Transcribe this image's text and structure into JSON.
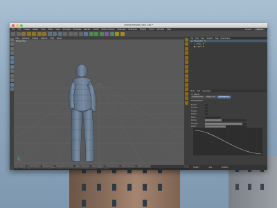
{
  "window": {
    "title": "characermodel_var1.c4d *"
  },
  "menubar": {
    "items": [
      "File",
      "Edit",
      "Create",
      "Select",
      "Tools",
      "Mesh",
      "Snap",
      "Animate",
      "Simulate",
      "Render",
      "Sculpt",
      "Motion Tracker",
      "MoGraph",
      "Character",
      "Plugins",
      "Script",
      "Window",
      "Help"
    ],
    "layout_label": "Layout:",
    "layout_value": "Startup"
  },
  "viewport": {
    "menu": [
      "View",
      "Cameras",
      "Display",
      "Options",
      "Filter",
      "Panel"
    ],
    "label": "Perspective"
  },
  "object_manager": {
    "menu": [
      "File",
      "Edit",
      "View",
      "Objects",
      "Tags",
      "Bookmarks"
    ],
    "objects": [
      {
        "name": "Character",
        "selected": true
      },
      {
        "name": "Body",
        "selected": false
      },
      {
        "name": "Light",
        "selected": false
      }
    ]
  },
  "attribute_manager": {
    "menu": [
      "Mode",
      "Edit",
      "User Data"
    ],
    "title": "Move",
    "tabs": [
      "Modeling Axis",
      "Object Axis",
      "Soft Selection"
    ],
    "active_tab": "Soft Selection",
    "section": "Soft Selection",
    "fields": [
      {
        "label": "Enable",
        "value": ""
      },
      {
        "label": "Preview",
        "value": ""
      },
      {
        "label": "Surface",
        "value": ""
      },
      {
        "label": "Rubber",
        "value": ""
      },
      {
        "label": "Mode",
        "value": ""
      },
      {
        "label": "Radius",
        "value": "",
        "fill": 0.4
      },
      {
        "label": "Strength",
        "value": "",
        "fill": 0.9
      },
      {
        "label": "Width",
        "value": "",
        "fill": 0.5
      }
    ]
  },
  "coordinates": {
    "headers": [
      "Position",
      "Size",
      "Rotation"
    ]
  },
  "bottom_tabs": [
    "Live Selection",
    "Loop Selection",
    "Ring Selection",
    "Phong Break Selection",
    "Select Connected",
    "Grow Selection",
    "Shrink Selection",
    "Select Connected",
    "Hide Connected"
  ],
  "statusbar": {
    "text": "Move: Click and drag to move elements. Hold down SHIFT to quantize movement / add to the selection in point mode, CTRL to remove."
  },
  "colors": {
    "accent": "#e0a030",
    "selection": "#5e7ea6",
    "mesh": "#6f8296"
  }
}
